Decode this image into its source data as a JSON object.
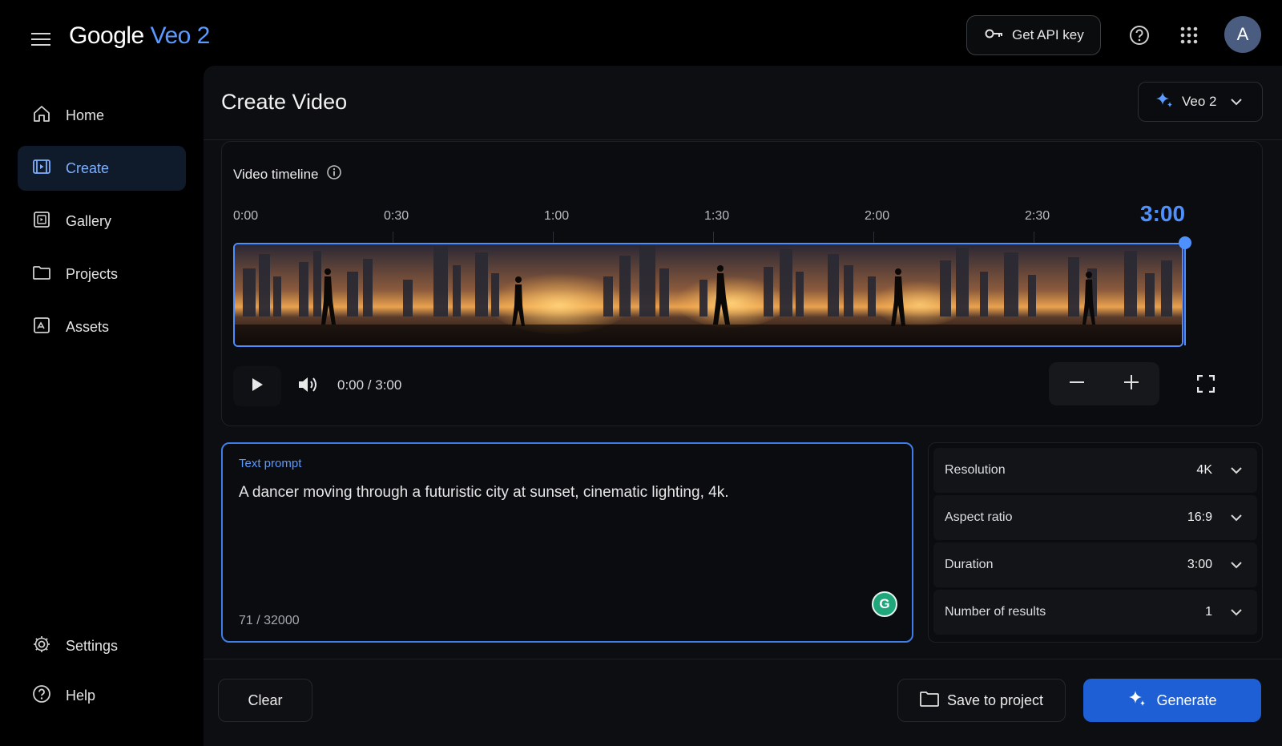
{
  "app": {
    "brand_google": "Google",
    "brand_product": "Veo 2",
    "api_key_label": "Get API key",
    "avatar_initial": "A"
  },
  "icons": {
    "menu": "menu-icon",
    "key": "key-icon",
    "help": "help-circle-icon",
    "apps": "apps-grid-icon",
    "sparkle": "sparkle-icon",
    "play": "play-icon",
    "volume": "volume-icon",
    "zoom_out": "minus-icon",
    "zoom_in": "plus-icon",
    "fullscreen": "fullscreen-icon",
    "folder": "folder-icon",
    "info": "info-icon",
    "chevron": "chevron-down-icon"
  },
  "colors": {
    "accent": "#4f90ff",
    "generate_button": "#1f5fd6",
    "active_nav_bg": "#0f1a2b"
  },
  "sidebar": {
    "items": [
      {
        "label": "Home",
        "active": false
      },
      {
        "label": "Create",
        "active": true
      },
      {
        "label": "Gallery",
        "active": false
      },
      {
        "label": "Projects",
        "active": false
      },
      {
        "label": "Assets",
        "active": false
      }
    ],
    "bottom_items": [
      {
        "label": "Settings"
      },
      {
        "label": "Help"
      }
    ]
  },
  "main": {
    "title": "Create Video",
    "model_selector": "Veo 2"
  },
  "timeline": {
    "title": "Video timeline",
    "ticks": [
      "0:00",
      "0:30",
      "1:00",
      "1:30",
      "2:00",
      "2:30"
    ],
    "current_marker": "3:00",
    "time_readout": "0:00 / 3:00"
  },
  "prompt": {
    "label": "Text prompt",
    "value": "A dancer moving through a futuristic city at sunset, cinematic lighting, 4k.",
    "counter": "71 / 32000",
    "assistant_badge": "G"
  },
  "settings": {
    "rows": [
      {
        "label": "Resolution",
        "value": "4K"
      },
      {
        "label": "Aspect ratio",
        "value": "16:9"
      },
      {
        "label": "Duration",
        "value": "3:00"
      },
      {
        "label": "Number of results",
        "value": "1"
      }
    ]
  },
  "actions": {
    "clear": "Clear",
    "save": "Save to project",
    "generate": "Generate"
  }
}
